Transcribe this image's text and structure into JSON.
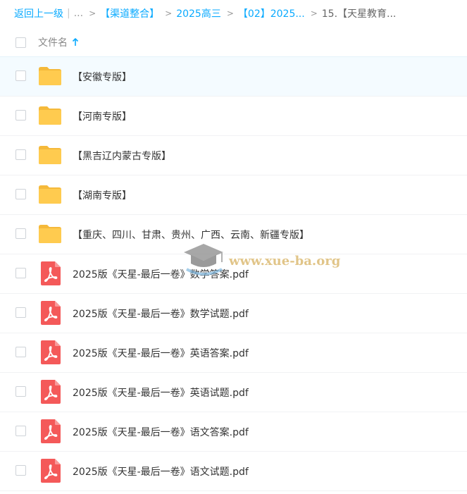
{
  "breadcrumb": {
    "back": "返回上一级",
    "sep": "|",
    "ellipsis": "...",
    "items": [
      "【渠道整合】",
      "2025高三",
      "【02】2025..."
    ],
    "current": "15.【天星教育..."
  },
  "header": {
    "column_label": "文件名"
  },
  "files": [
    {
      "type": "folder",
      "name": "【安徽专版】"
    },
    {
      "type": "folder",
      "name": "【河南专版】"
    },
    {
      "type": "folder",
      "name": "【黑吉辽内蒙古专版】"
    },
    {
      "type": "folder",
      "name": "【湖南专版】"
    },
    {
      "type": "folder",
      "name": "【重庆、四川、甘肃、贵州、广西、云南、新疆专版】"
    },
    {
      "type": "pdf",
      "name": "2025版《天星-最后一卷》数学答案.pdf"
    },
    {
      "type": "pdf",
      "name": "2025版《天星-最后一卷》数学试题.pdf"
    },
    {
      "type": "pdf",
      "name": "2025版《天星-最后一卷》英语答案.pdf"
    },
    {
      "type": "pdf",
      "name": "2025版《天星-最后一卷》英语试题.pdf"
    },
    {
      "type": "pdf",
      "name": "2025版《天星-最后一卷》语文答案.pdf"
    },
    {
      "type": "pdf",
      "name": "2025版《天星-最后一卷》语文试题.pdf"
    }
  ],
  "watermark": {
    "text": "www.xue-ba.org"
  },
  "colors": {
    "link": "#09aaff",
    "folder": "#ffc94a",
    "pdf": "#f45959"
  }
}
